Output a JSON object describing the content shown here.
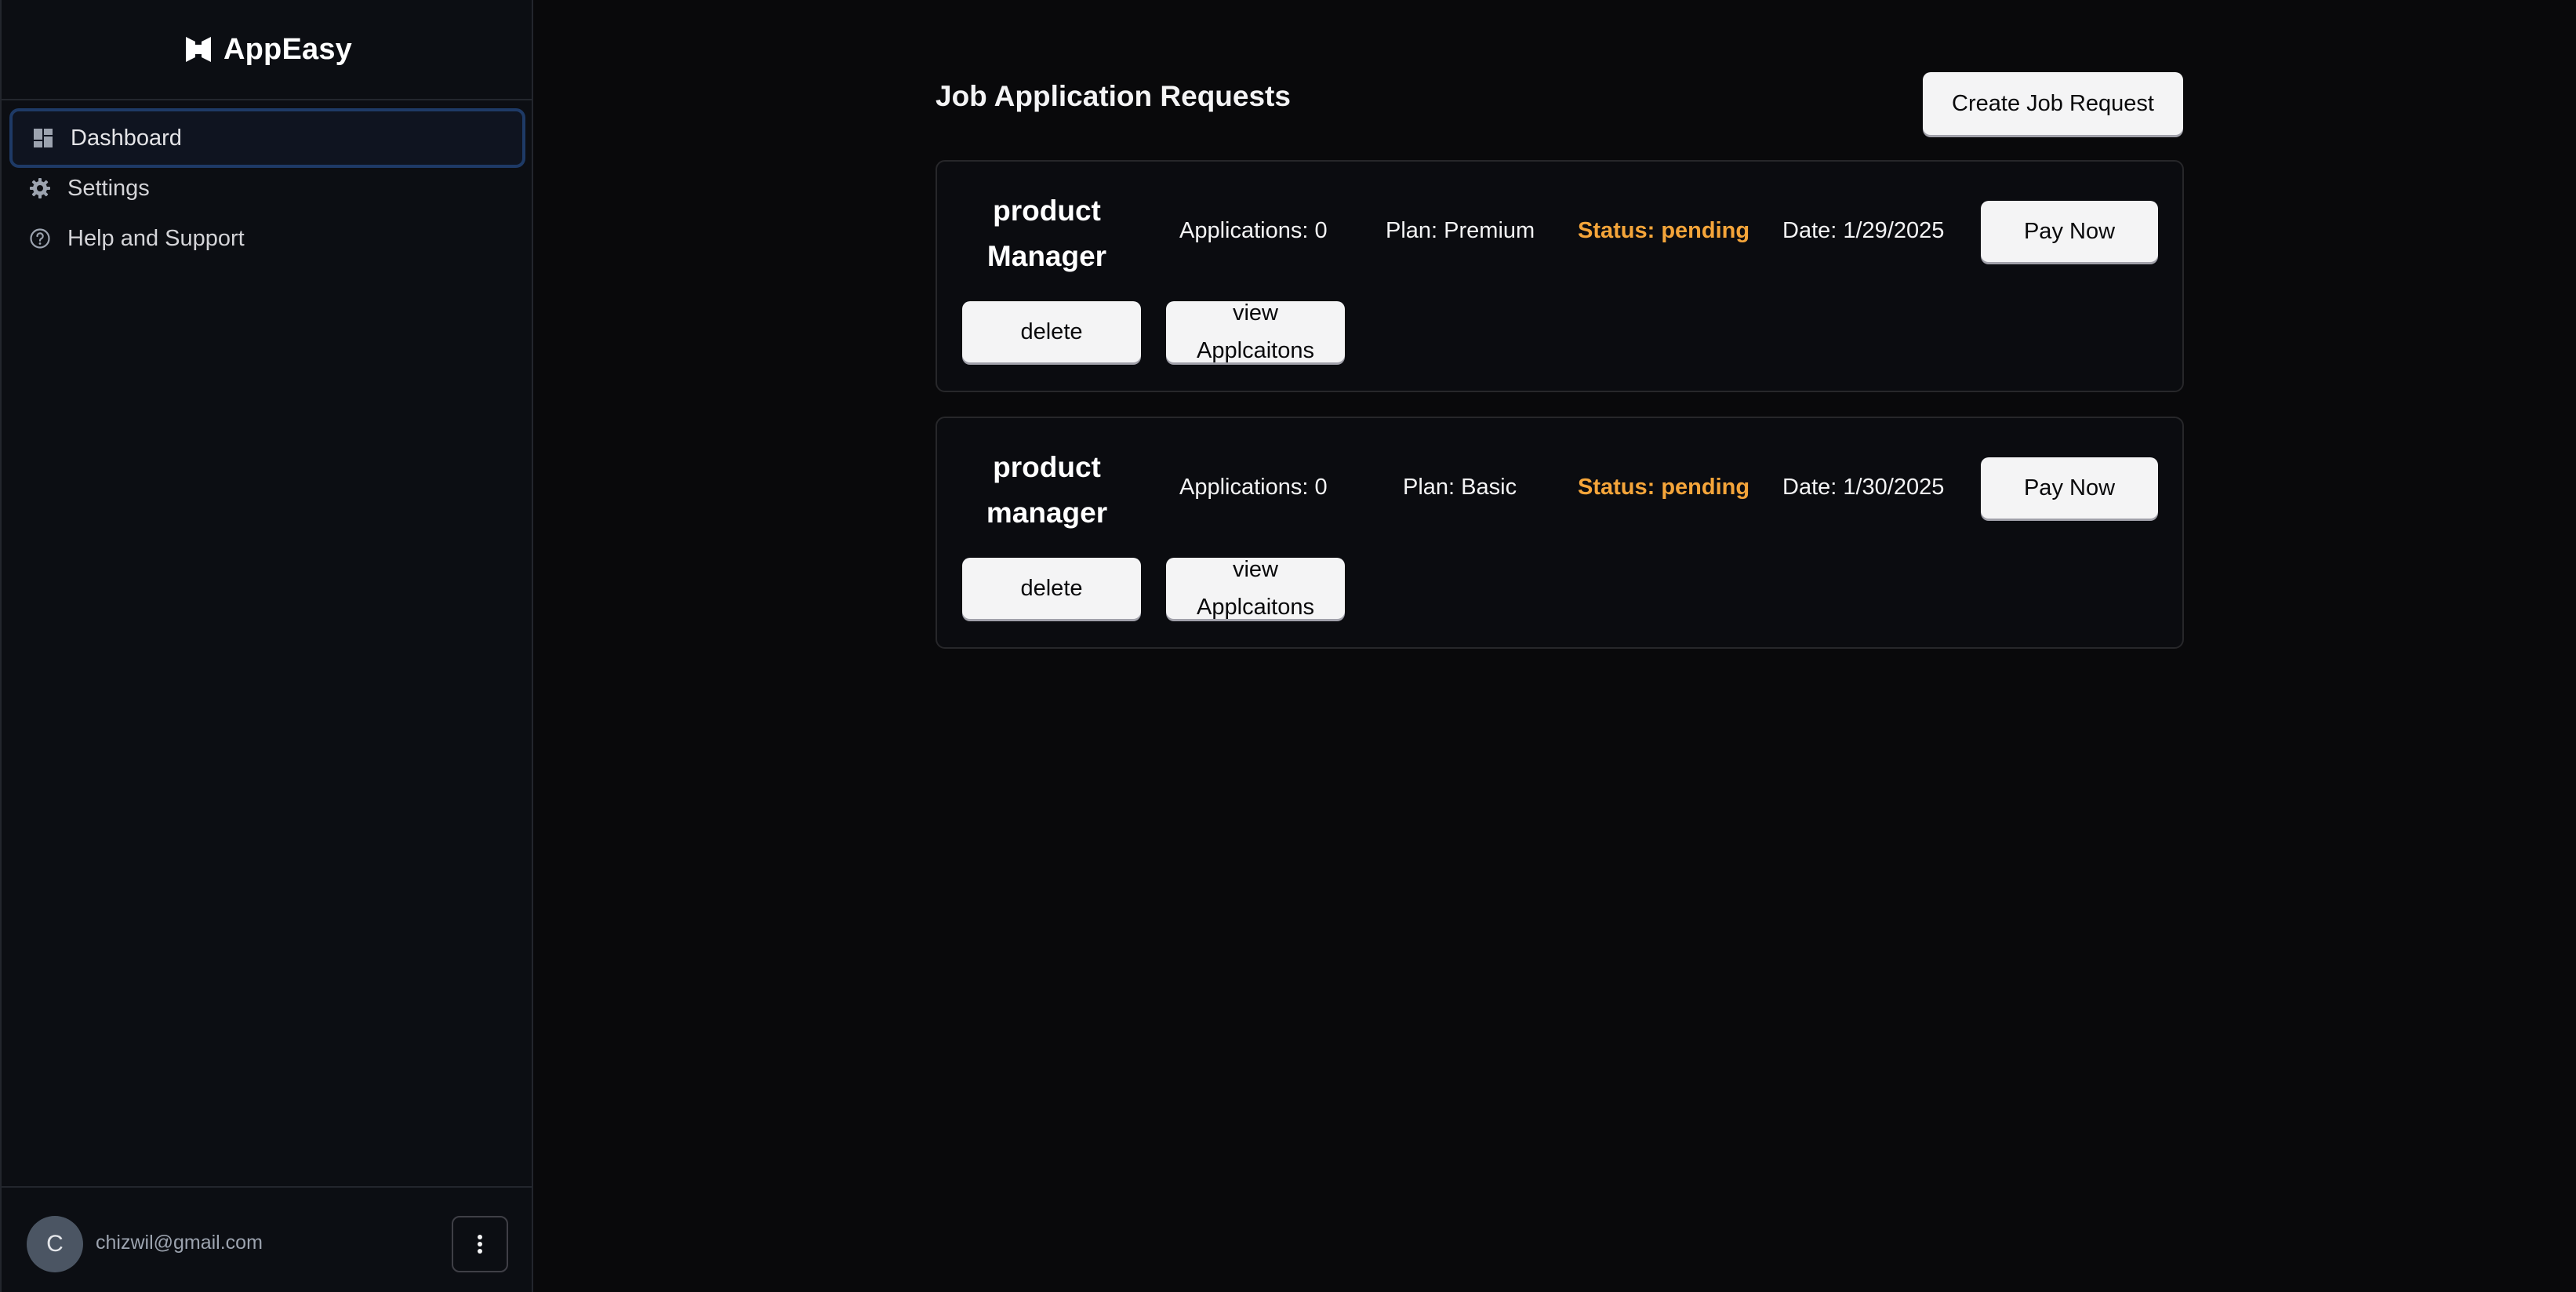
{
  "brand": {
    "name": "AppEasy"
  },
  "sidebar": {
    "items": [
      {
        "label": "Dashboard",
        "icon": "dashboard-icon",
        "active": true
      },
      {
        "label": "Settings",
        "icon": "gear-icon",
        "active": false
      },
      {
        "label": "Help and Support",
        "icon": "help-circle-icon",
        "active": false
      }
    ]
  },
  "user": {
    "initial": "C",
    "email": "chizwil@gmail.com"
  },
  "main": {
    "title": "Job Application Requests",
    "create_label": "Create Job Request",
    "jobs": [
      {
        "title_line1": "product",
        "title_line2": "Manager",
        "applications": "Applications: 0",
        "plan": "Plan: Premium",
        "status": "Status: pending",
        "date": "Date: 1/29/2025",
        "pay_label": "Pay Now",
        "delete_label": "delete",
        "view_line1": "view",
        "view_line2": "Applcaitons"
      },
      {
        "title_line1": "product",
        "title_line2": "manager",
        "applications": "Applications: 0",
        "plan": "Plan: Basic",
        "status": "Status: pending",
        "date": "Date: 1/30/2025",
        "pay_label": "Pay Now",
        "delete_label": "delete",
        "view_line1": "view",
        "view_line2": "Applcaitons"
      }
    ]
  },
  "colors": {
    "background": "#09090b",
    "sidebar": "#0c0e13",
    "status_pending": "#f5a53a",
    "button_light": "#f4f4f5",
    "active_border": "#1e3a66"
  }
}
